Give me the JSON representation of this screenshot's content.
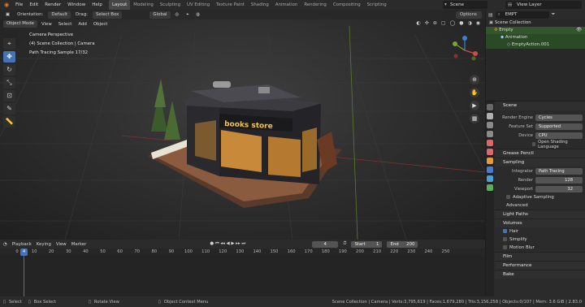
{
  "menu": {
    "items": [
      "File",
      "Edit",
      "Render",
      "Window",
      "Help"
    ],
    "workspaces": [
      "Layout",
      "Modeling",
      "Sculpting",
      "UV Editing",
      "Texture Paint",
      "Shading",
      "Animation",
      "Rendering",
      "Compositing",
      "Scripting"
    ],
    "active_workspace": "Layout",
    "scene_name": "Scene",
    "view_layer": "View Layer"
  },
  "viewport": {
    "orientation_label": "Orientation:",
    "orientation_value": "Default",
    "drag_label": "Drag:",
    "drag_value": "Select Box",
    "transform": "Global",
    "options": "Options",
    "mode": "Object Mode",
    "menus": [
      "View",
      "Select",
      "Add",
      "Object"
    ],
    "info": [
      "Camera Perspective",
      "(4) Scene Collection | Camera",
      "Path Tracing Sample 17/32"
    ],
    "sign_text": "books store"
  },
  "outliner": {
    "search_value": "EMPT",
    "rows": [
      "Scene Collection",
      "Empty",
      "Animation",
      "EmptyAction.001"
    ]
  },
  "properties": {
    "object_name": "Scene",
    "render_engine_label": "Render Engine",
    "render_engine": "Cycles",
    "feature_set_label": "Feature Set",
    "feature_set": "Supported",
    "device_label": "Device",
    "device": "CPU",
    "osl_label": "Open Shading Language",
    "sections": {
      "grease_pencil": "Grease Pencil",
      "sampling": "Sampling",
      "integrator_label": "Integrator",
      "integrator": "Path Tracing",
      "render_label": "Render",
      "render_samples": "128",
      "viewport_label": "Viewport",
      "viewport_samples": "32",
      "adaptive": "Adaptive Sampling",
      "advanced": "Advanced",
      "light_paths": "Light Paths",
      "volumes": "Volumes",
      "hair": "Hair",
      "simplify": "Simplify",
      "motion_blur": "Motion Blur",
      "film": "Film",
      "performance": "Performance",
      "bake": "Bake"
    }
  },
  "timeline": {
    "menus": [
      "Playback",
      "Keying",
      "View",
      "Marker"
    ],
    "current_frame": "4",
    "start_label": "Start",
    "start": "1",
    "end_label": "End",
    "end": "200",
    "ticks": [
      "0",
      "10",
      "20",
      "30",
      "40",
      "50",
      "60",
      "70",
      "80",
      "90",
      "100",
      "110",
      "120",
      "130",
      "140",
      "150",
      "160",
      "170",
      "180",
      "190",
      "200",
      "210",
      "220",
      "230",
      "240",
      "250"
    ],
    "playhead": "4"
  },
  "status": {
    "select": "Select",
    "box_select": "Box Select",
    "rotate_view": "Rotate View",
    "context_menu": "Object Context Menu",
    "stats": "Scene Collection | Camera | Verts:3,795,619 | Faces:1,679,280 | Tris:3,156,258 | Objects:0/107 | Mem: 3.6 GiB | 2.83.0"
  },
  "colors": {
    "accent": "#4772b3",
    "sign": "#f5c542",
    "outliner_selected": "#33552c"
  }
}
